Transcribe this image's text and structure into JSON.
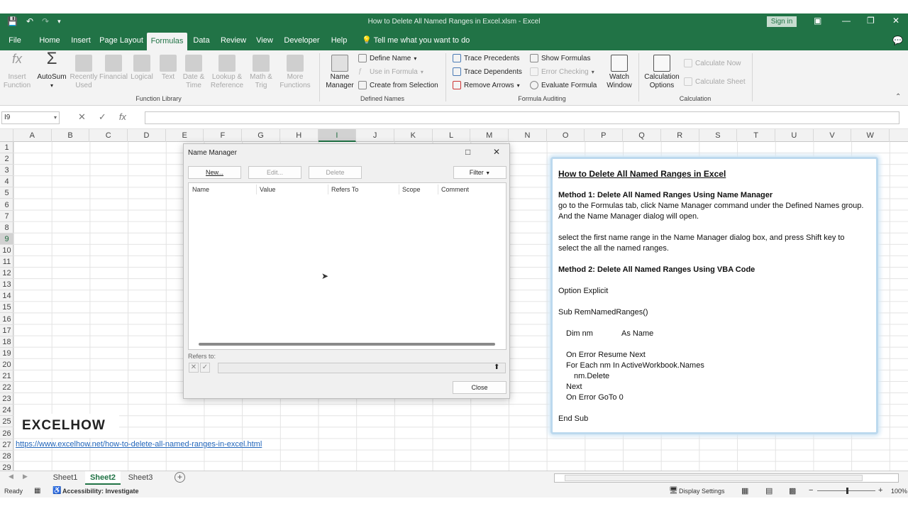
{
  "window": {
    "title": "How to Delete All Named Ranges in Excel.xlsm  -  Excel",
    "signin": "Sign in"
  },
  "tabs": [
    "File",
    "Home",
    "Insert",
    "Page Layout",
    "Formulas",
    "Data",
    "Review",
    "View",
    "Developer",
    "Help"
  ],
  "tell_me": "Tell me what you want to do",
  "ribbon": {
    "function_library": {
      "buttons": [
        {
          "label": "Insert\nFunction"
        },
        {
          "label": "AutoSum"
        },
        {
          "label": "Recently\nUsed"
        },
        {
          "label": "Financial"
        },
        {
          "label": "Logical"
        },
        {
          "label": "Text"
        },
        {
          "label": "Date &\nTime"
        },
        {
          "label": "Lookup &\nReference"
        },
        {
          "label": "Math &\nTrig"
        },
        {
          "label": "More\nFunctions"
        }
      ],
      "group_label": "Function Library"
    },
    "defined_names": {
      "name_manager": "Name\nManager",
      "define_name": "Define Name",
      "use_in_formula": "Use in Formula",
      "create_from_selection": "Create from Selection",
      "group_label": "Defined Names"
    },
    "formula_auditing": {
      "trace_precedents": "Trace Precedents",
      "trace_dependents": "Trace Dependents",
      "remove_arrows": "Remove Arrows",
      "show_formulas": "Show Formulas",
      "error_checking": "Error Checking",
      "evaluate_formula": "Evaluate Formula",
      "watch_window": "Watch\nWindow",
      "group_label": "Formula Auditing"
    },
    "calculation": {
      "calculation_options": "Calculation\nOptions",
      "calculate_now": "Calculate Now",
      "calculate_sheet": "Calculate Sheet",
      "group_label": "Calculation"
    }
  },
  "formula_bar": {
    "name_box": "I9",
    "fx": "fx"
  },
  "columns": [
    "A",
    "B",
    "C",
    "D",
    "E",
    "F",
    "G",
    "H",
    "I",
    "J",
    "K",
    "L",
    "M",
    "N",
    "O",
    "P",
    "Q",
    "R",
    "S",
    "T",
    "U",
    "V",
    "W"
  ],
  "selected_column": "I",
  "rows": [
    "1",
    "2",
    "3",
    "4",
    "5",
    "6",
    "7",
    "8",
    "9",
    "10",
    "11",
    "12",
    "13",
    "14",
    "15",
    "16",
    "17",
    "18",
    "19",
    "20",
    "21",
    "22",
    "23",
    "24",
    "25",
    "26",
    "27",
    "28",
    "29"
  ],
  "selected_row": "9",
  "sheets": [
    "Sheet1",
    "Sheet2",
    "Sheet3"
  ],
  "active_sheet": "Sheet2",
  "status": {
    "ready": "Ready",
    "accessibility": "Accessibility: Investigate",
    "display_settings": "Display Settings",
    "zoom": "100%"
  },
  "dialog": {
    "title": "Name Manager",
    "new": "New...",
    "edit": "Edit...",
    "delete": "Delete",
    "filter": "Filter",
    "columns": [
      "Name",
      "Value",
      "Refers To",
      "Scope",
      "Comment"
    ],
    "refers_to_label": "Refers to:",
    "close": "Close"
  },
  "panel": {
    "title": "How to Delete All Named Ranges in Excel",
    "m1_heading": "Method 1: Delete All Named Ranges Using Name Manager",
    "m1_line1": "go to the Formulas tab, click Name Manager command under the Defined Names group.",
    "m1_line2": "And the Name Manager dialog will open.",
    "m1_line3": "select the first name range in the Name Manager dialog box, and press Shift key to",
    "m1_line4": "select the all the named ranges.",
    "m2_heading": "Method 2: Delete All Named Ranges Using VBA Code",
    "code_option": "Option Explicit",
    "code_sub": "Sub RemNamedRanges()",
    "code_dim_a": "Dim nm",
    "code_dim_b": "As Name",
    "code_onerror": "On Error Resume Next",
    "code_foreach": "For Each nm In ActiveWorkbook.Names",
    "code_delete": "nm.Delete",
    "code_next": "Next",
    "code_goto": "On Error GoTo 0",
    "code_end": "End Sub"
  },
  "brand": "EXCELHOW",
  "url": "https://www.excelhow.net/how-to-delete-all-named-ranges-in-excel.html",
  "colors": {
    "excel_green": "#217346",
    "panel_border": "#bcd9ee",
    "link": "#2266bb"
  }
}
